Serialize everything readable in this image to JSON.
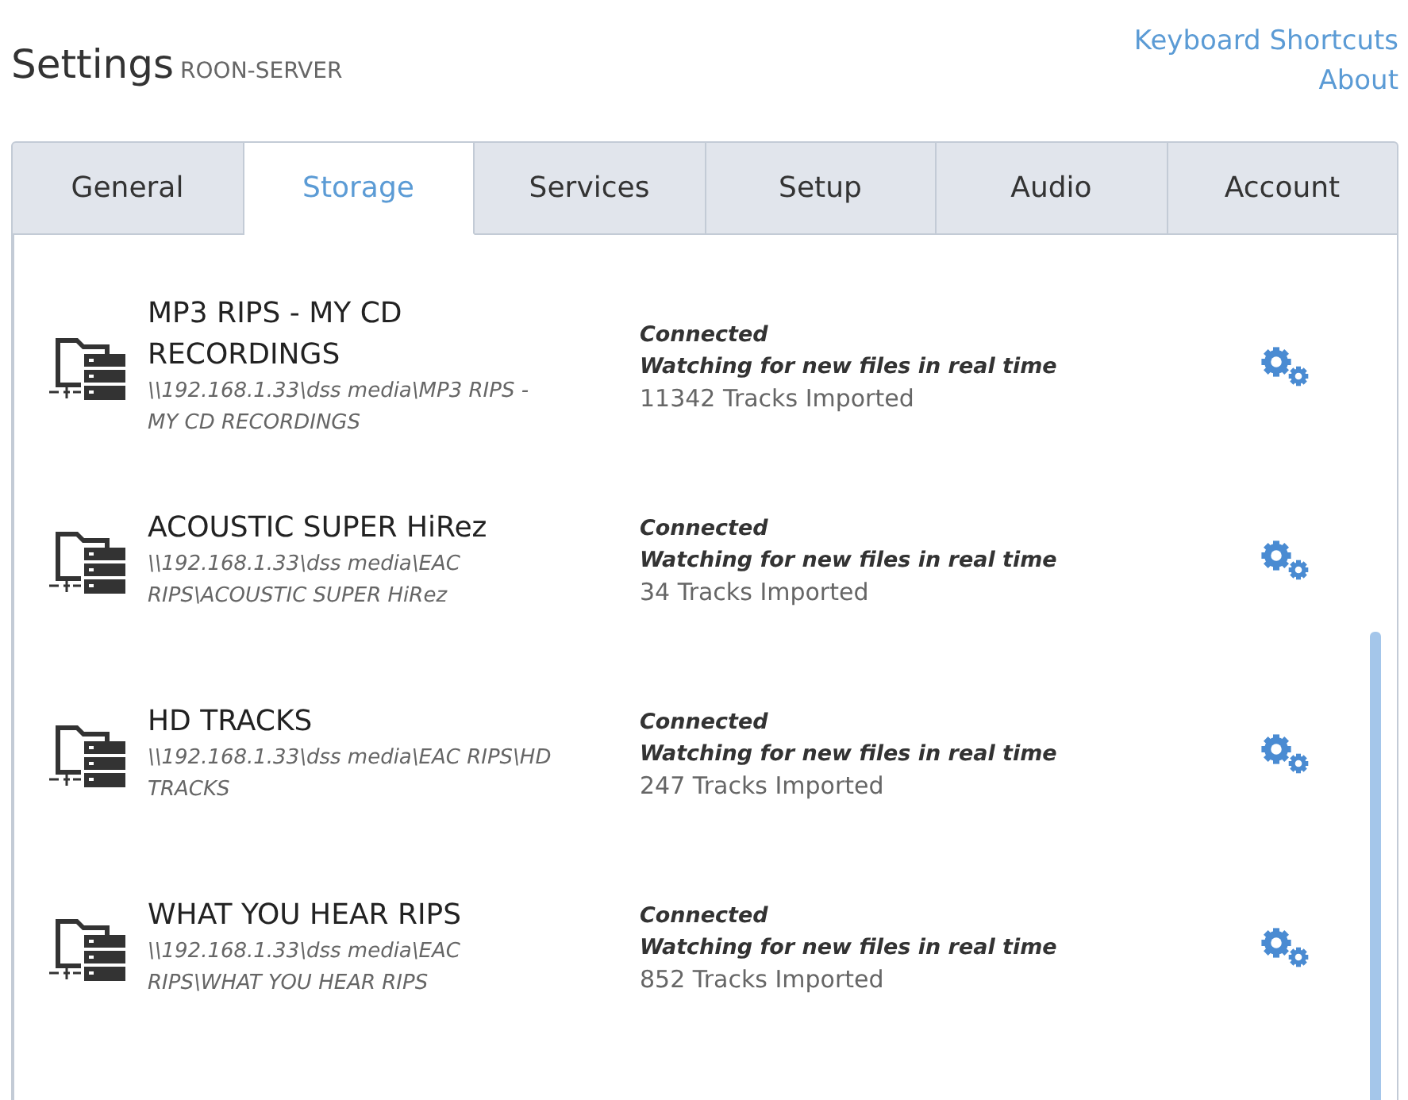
{
  "header": {
    "title": "Settings",
    "subtitle": "ROON-SERVER",
    "links": [
      "Keyboard Shortcuts",
      "About"
    ]
  },
  "tabs": [
    {
      "label": "General",
      "selected": false
    },
    {
      "label": "Storage",
      "selected": true
    },
    {
      "label": "Services",
      "selected": false
    },
    {
      "label": "Setup",
      "selected": false
    },
    {
      "label": "Audio",
      "selected": false
    },
    {
      "label": "Account",
      "selected": false
    }
  ],
  "storage_locations": [
    {
      "name": "MP3 RIPS - MY CD RECORDINGS",
      "path": "\\\\192.168.1.33\\dss media\\MP3 RIPS - MY CD RECORDINGS",
      "status": "Connected",
      "watch": "Watching for new files in real time",
      "tracks": "11342 Tracks Imported"
    },
    {
      "name": "ACOUSTIC SUPER HiRez",
      "path": "\\\\192.168.1.33\\dss media\\EAC RIPS\\ACOUSTIC SUPER HiRez",
      "status": "Connected",
      "watch": "Watching for new files in real time",
      "tracks": "34 Tracks Imported"
    },
    {
      "name": "HD TRACKS",
      "path": "\\\\192.168.1.33\\dss media\\EAC RIPS\\HD TRACKS",
      "status": "Connected",
      "watch": "Watching for new files in real time",
      "tracks": "247 Tracks Imported"
    },
    {
      "name": "WHAT YOU HEAR RIPS",
      "path": "\\\\192.168.1.33\\dss media\\EAC RIPS\\WHAT YOU HEAR RIPS",
      "status": "Connected",
      "watch": "Watching for new files in real time",
      "tracks": "852 Tracks Imported"
    }
  ]
}
